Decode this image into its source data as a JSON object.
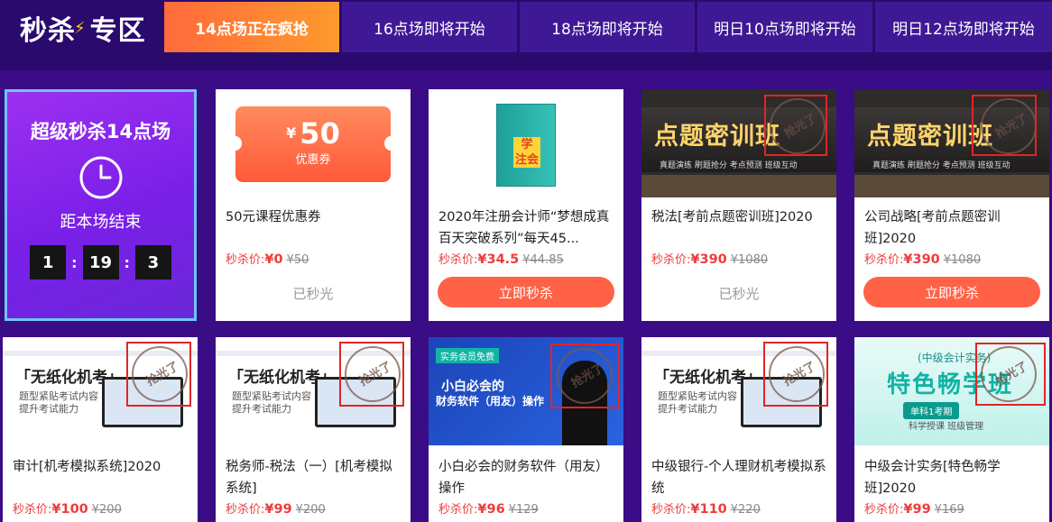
{
  "header": {
    "logo_text": "秒杀",
    "logo_suffix": "专区",
    "tabs": [
      {
        "label": "14点场正在疯抢",
        "active": true
      },
      {
        "label": "16点场即将开始",
        "active": false
      },
      {
        "label": "18点场即将开始",
        "active": false
      },
      {
        "label": "明日10点场即将开始",
        "active": false
      },
      {
        "label": "明日12点场即将开始",
        "active": false
      }
    ]
  },
  "countdown": {
    "title": "超级秒杀14点场",
    "subtitle": "距本场结束",
    "hours": "1",
    "minutes": "19",
    "seconds": "3"
  },
  "labels": {
    "price_prefix": "秒杀价:",
    "buy_button": "立即秒杀",
    "sold_out": "已秒光",
    "stamp": "抢光了"
  },
  "products": [
    {
      "title": "50元课程优惠券",
      "price": "¥0",
      "original": "¥50",
      "status": "sold_out",
      "coupon_symbol": "¥",
      "coupon_amount": "50",
      "coupon_label": "优惠券"
    },
    {
      "title": "2020年注册会计师“梦想成真百天突破系列”每天45...",
      "price": "¥34.5",
      "original": "¥44.85",
      "status": "available"
    },
    {
      "title": "税法[考前点题密训班]2020",
      "price": "¥390",
      "original": "¥1080",
      "status": "sold_out",
      "banner_main": "点题密训班",
      "banner_sub": "真题演练  刷题抢分  考点预测  班级互动"
    },
    {
      "title": "公司战略[考前点题密训班]2020",
      "price": "¥390",
      "original": "¥1080",
      "status": "available",
      "banner_main": "点题密训班",
      "banner_sub": "真题演练  刷题抢分  考点预测  班级互动"
    },
    {
      "title": "审计[机考模拟系统]2020",
      "price": "¥100",
      "original": "¥200",
      "banner_main": "「无纸化机考」",
      "banner_sub1": "题型紧贴考试内容",
      "banner_sub2": "提升考试能力"
    },
    {
      "title": "税务师-税法（一）[机考模拟系统]",
      "price": "¥99",
      "original": "¥200",
      "banner_main": "「无纸化机考」",
      "banner_sub1": "题型紧贴考试内容",
      "banner_sub2": "提升考试能力"
    },
    {
      "title": "小白必会的财务软件（用友）操作",
      "price": "¥96",
      "original": "¥129",
      "banner_tag": "实务会员免费",
      "banner_main": "小白必会的",
      "banner_sub": "财务软件（用友）操作"
    },
    {
      "title": "中级银行-个人理财机考模拟系统",
      "price": "¥110",
      "original": "¥220",
      "banner_main": "「无纸化机考」",
      "banner_sub1": "题型紧贴考试内容",
      "banner_sub2": "提升考试能力"
    },
    {
      "title": "中级会计实务[特色畅学班]2020",
      "price": "¥99",
      "original": "¥169",
      "banner_top": "(中级会计实务)",
      "banner_main": "特色畅学班",
      "banner_badge": "单科1考期",
      "banner_sub": "科学授课  班级管理"
    }
  ]
}
